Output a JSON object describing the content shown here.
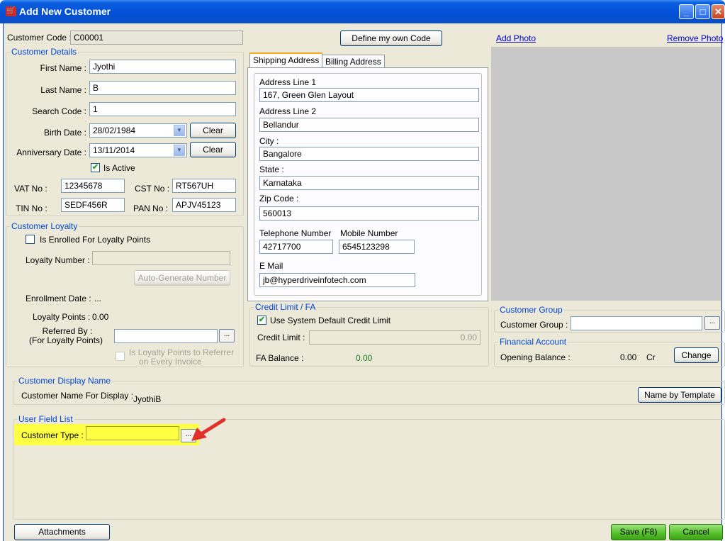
{
  "window": {
    "title": "Add New Customer"
  },
  "top": {
    "customer_code_label": "Customer Code :",
    "customer_code_value": "C00001",
    "define_code_button": "Define my own Code",
    "add_photo": "Add Photo",
    "remove_photo": "Remove Photo"
  },
  "customer_details": {
    "title": "Customer Details",
    "first_name_label": "First Name :",
    "first_name": "Jyothi",
    "last_name_label": "Last Name :",
    "last_name": "B",
    "search_code_label": "Search Code :",
    "search_code": "1",
    "birth_date_label": "Birth Date :",
    "birth_date": "28/02/1984",
    "anniversary_label": "Anniversary Date :",
    "anniversary_date": "13/11/2014",
    "clear_label": "Clear",
    "is_active_label": "Is Active",
    "vat_label": "VAT No :",
    "vat": "12345678",
    "cst_label": "CST No :",
    "cst": "RT567UH",
    "tin_label": "TIN No :",
    "tin": "SEDF456R",
    "pan_label": "PAN No :",
    "pan": "APJV45123"
  },
  "loyalty": {
    "title": "Customer Loyalty",
    "enrolled_label": "Is Enrolled For Loyalty Points",
    "number_label": "Loyalty Number :",
    "number": "",
    "auto_button": "Auto-Generate Number",
    "enrollment_label": "Enrollment Date :",
    "enrollment_value": "...",
    "points_label": "Loyalty Points :",
    "points_value": "0.00",
    "referred_label_1": "Referred By :",
    "referred_label_2": "(For Loyalty Points)",
    "referrer_label_1": "Is Loyalty Points to Referrer",
    "referrer_label_2": "on Every Invoice",
    "dots": "..."
  },
  "address": {
    "tabs": [
      "Shipping Address",
      "Billing Address"
    ],
    "line1_label": "Address Line 1",
    "line1": "167, Green Glen Layout",
    "line2_label": "Address Line 2",
    "line2": "Bellandur",
    "city_label": "City :",
    "city": "Bangalore",
    "state_label": "State :",
    "state": "Karnataka",
    "zip_label": "Zip Code :",
    "zip": "560013",
    "telephone_label": "Telephone Number",
    "telephone": "42717700",
    "mobile_label": "Mobile Number",
    "mobile": "6545123298",
    "email_label": "E Mail",
    "email": "jb@hyperdriveinfotech.com"
  },
  "credit": {
    "title": "Credit Limit / FA",
    "default_label": "Use System Default Credit Limit",
    "limit_label": "Credit Limit :",
    "limit_value": "0.00",
    "fa_label": "FA Balance :",
    "fa_value": "0.00"
  },
  "group": {
    "title": "Customer Group",
    "label": "Customer Group :",
    "value": "",
    "dots": "..."
  },
  "financial": {
    "title": "Financial Account",
    "label": "Opening Balance :",
    "value": "0.00",
    "unit": "Cr",
    "change_button": "Change"
  },
  "display_name": {
    "title": "Customer Display Name",
    "label": "Customer Name For Display :",
    "value": "JyothiB",
    "template_button": "Name by Template"
  },
  "user_fields": {
    "title": "User Field List",
    "customer_type_label": "Customer Type :",
    "customer_type_value": "",
    "dots": "..."
  },
  "bottom": {
    "attachments": "Attachments",
    "save": "Save (F8)",
    "cancel": "Cancel"
  },
  "colors": {
    "highlight": "#ffff44",
    "arrow": "#e0322a",
    "title_blue": "#0046d5",
    "success_green": "#1a7a1a"
  }
}
